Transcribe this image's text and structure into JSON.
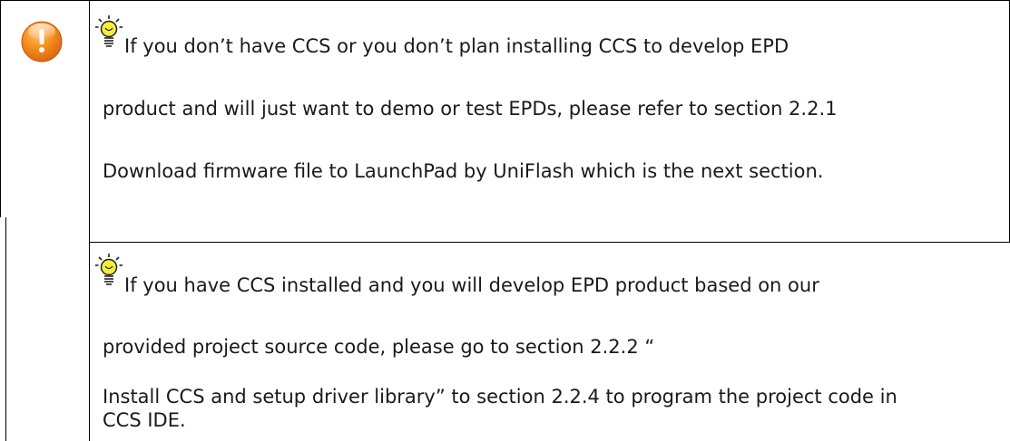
{
  "icons": {
    "warning": "exclamation-warning-icon",
    "tip": "lightbulb-tip-icon"
  },
  "colors": {
    "warning_orange": "#f07a1c",
    "bulb_yellow": "#f3ee3a",
    "text": "#1a1a1a"
  },
  "note_1": {
    "lines": [
      "If you don’t have CCS or you don’t plan installing CCS to develop EPD",
      "product and will just want to demo or test EPDs, please refer to section 2.2.1",
      "Download firmware file to LaunchPad by UniFlash which is the next section."
    ]
  },
  "note_2": {
    "lines": [
      "If you have CCS installed and you will develop EPD product based on our",
      "provided project source code, please go to section 2.2.2 “",
      "Install CCS and setup driver library” to section 2.2.4 to program the project code in",
      "CCS IDE."
    ]
  }
}
